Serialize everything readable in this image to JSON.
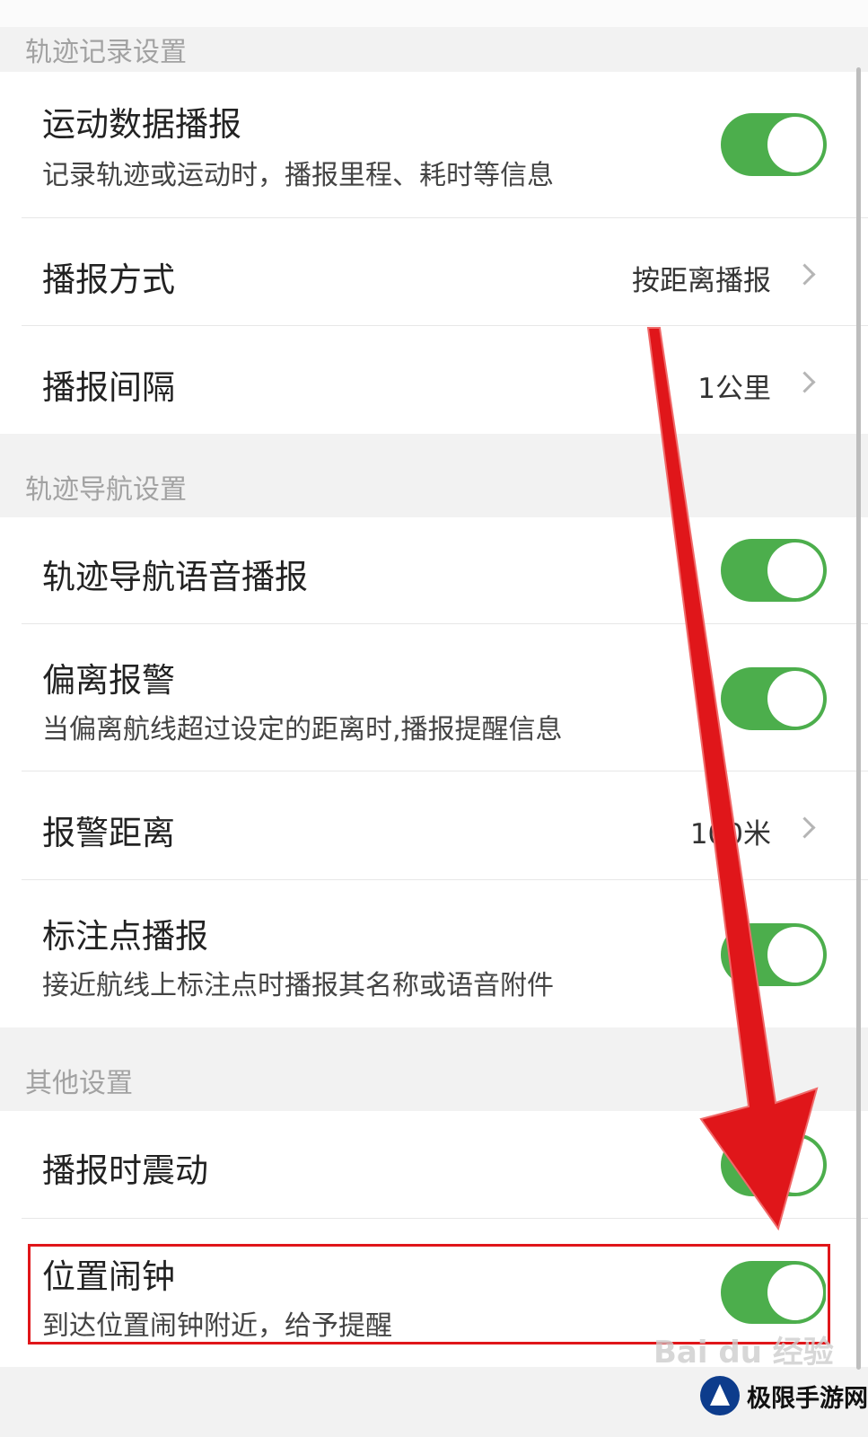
{
  "sections": [
    {
      "header": "轨迹记录设置",
      "rows": [
        {
          "title": "运动数据播报",
          "subtitle": "记录轨迹或运动时，播报里程、耗时等信息",
          "toggle": true
        },
        {
          "title": "播报方式",
          "value": "按距离播报"
        },
        {
          "title": "播报间隔",
          "value": "1公里"
        }
      ]
    },
    {
      "header": "轨迹导航设置",
      "rows": [
        {
          "title": "轨迹导航语音播报",
          "toggle": true
        },
        {
          "title": "偏离报警",
          "subtitle": "当偏离航线超过设定的距离时,播报提醒信息",
          "toggle": true
        },
        {
          "title": "报警距离",
          "value": "100米"
        },
        {
          "title": "标注点播报",
          "subtitle": "接近航线上标注点时播报其名称或语音附件",
          "toggle": true
        }
      ]
    },
    {
      "header": "其他设置",
      "rows": [
        {
          "title": "播报时震动",
          "toggle": true
        },
        {
          "title": "位置闹钟",
          "subtitle": "到达位置闹钟附近，给予提醒",
          "toggle": true
        }
      ]
    }
  ],
  "watermark": "Bai du 经验",
  "brand": "极限手游网",
  "colors": {
    "toggle_on": "#4cae4c",
    "arrow": "#e0161a",
    "highlight": "#e0161a"
  }
}
